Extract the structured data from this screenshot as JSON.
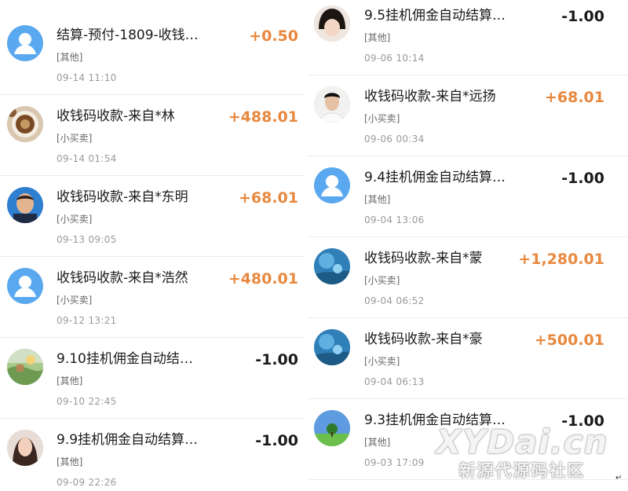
{
  "left": {
    "rows": [
      {
        "title": "结算-预付-1809-收钱…",
        "tag": "[其他]",
        "time": "09-14  11:10",
        "amount": "+0.50",
        "sign": "pos",
        "avatar": "default-user-icon"
      },
      {
        "title": "收钱码收款-来自*林",
        "tag": "[小买卖]",
        "time": "09-14  01:54",
        "amount": "+488.01",
        "sign": "pos",
        "avatar": "coffee-cup-avatar"
      },
      {
        "title": "收钱码收款-来自*东明",
        "tag": "[小买卖]",
        "time": "09-13  09:05",
        "amount": "+68.01",
        "sign": "pos",
        "avatar": "man-face-avatar"
      },
      {
        "title": "收钱码收款-来自*浩然",
        "tag": "[小买卖]",
        "time": "09-12  13:21",
        "amount": "+480.01",
        "sign": "pos",
        "avatar": "default-user-icon"
      },
      {
        "title": "9.10挂机佣金自动结…",
        "tag": "[其他]",
        "time": "09-10  22:45",
        "amount": "-1.00",
        "sign": "neg",
        "avatar": "landscape-avatar"
      },
      {
        "title": "9.9挂机佣金自动结算…",
        "tag": "[其他]",
        "time": "09-09  22:26",
        "amount": "-1.00",
        "sign": "neg",
        "avatar": "woman-face-avatar"
      }
    ]
  },
  "right": {
    "rows": [
      {
        "title": "9.5挂机佣金自动结算…",
        "tag": "[其他]",
        "time": "09-06  10:14",
        "amount": "-1.00",
        "sign": "neg",
        "avatar": "child-face-avatar"
      },
      {
        "title": "收钱码收款-来自*远扬",
        "tag": "[小买卖]",
        "time": "09-06  00:34",
        "amount": "+68.01",
        "sign": "pos",
        "avatar": "young-man-avatar"
      },
      {
        "title": "9.4挂机佣金自动结算…",
        "tag": "[其他]",
        "time": "09-04  13:06",
        "amount": "-1.00",
        "sign": "neg",
        "avatar": "default-user-icon"
      },
      {
        "title": "收钱码收款-来自*蒙",
        "tag": "[小买卖]",
        "time": "09-04  06:52",
        "amount": "+1,280.01",
        "sign": "pos",
        "avatar": "underwater-avatar"
      },
      {
        "title": "收钱码收款-来自*豪",
        "tag": "[小买卖]",
        "time": "09-04  06:13",
        "amount": "+500.01",
        "sign": "pos",
        "avatar": "underwater-avatar"
      },
      {
        "title": "9.3挂机佣金自动结算…",
        "tag": "[其他]",
        "time": "09-03  17:09",
        "amount": "-1.00",
        "sign": "neg",
        "avatar": "tree-field-avatar"
      }
    ]
  },
  "watermark": {
    "line1": "XYDai.cn",
    "line2": "新源代源码社区"
  },
  "colors": {
    "positive": "#e8883e",
    "negative": "#1a1a1a",
    "avatar_default": "#5aa9f0"
  }
}
